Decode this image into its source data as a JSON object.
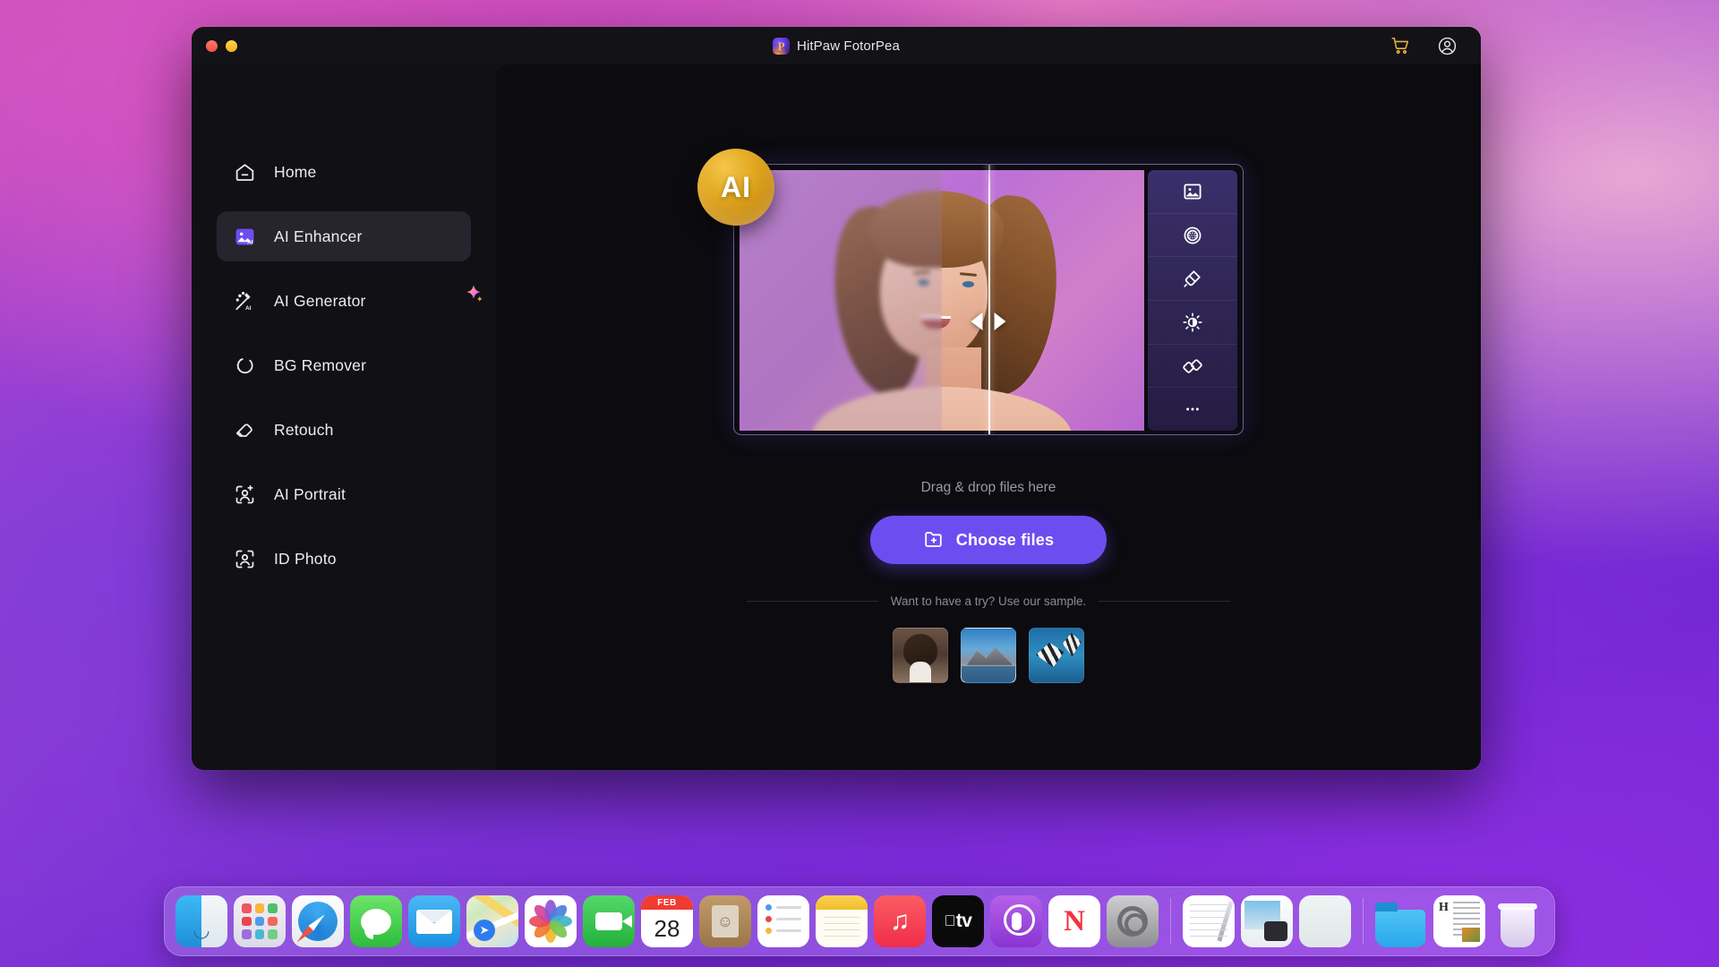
{
  "window": {
    "title": "HitPaw FotorPea",
    "logo_letter": "P",
    "traffic_lights": [
      "close",
      "minimize"
    ],
    "header_icons": [
      "cart-icon",
      "account-icon"
    ]
  },
  "sidebar": {
    "items": [
      {
        "label": "Home",
        "icon": "home-icon",
        "active": false,
        "badge": false
      },
      {
        "label": "AI Enhancer",
        "icon": "ai-enhancer-icon",
        "active": true,
        "badge": false
      },
      {
        "label": "AI Generator",
        "icon": "ai-generator-icon",
        "active": false,
        "badge": true
      },
      {
        "label": "BG Remover",
        "icon": "bg-remover-icon",
        "active": false,
        "badge": false
      },
      {
        "label": "Retouch",
        "icon": "retouch-icon",
        "active": false,
        "badge": false
      },
      {
        "label": "AI Portrait",
        "icon": "ai-portrait-icon",
        "active": false,
        "badge": false
      },
      {
        "label": "ID Photo",
        "icon": "id-photo-icon",
        "active": false,
        "badge": false
      }
    ]
  },
  "main": {
    "ai_badge_text": "AI",
    "preview_tools": [
      {
        "name": "image-enhance-icon"
      },
      {
        "name": "denoise-icon"
      },
      {
        "name": "stamp-icon"
      },
      {
        "name": "brightness-icon"
      },
      {
        "name": "patch-icon"
      },
      {
        "name": "more-options-icon"
      }
    ],
    "drop_text": "Drag & drop files here",
    "choose_files_label": "Choose files",
    "sample_prompt": "Want to have a try? Use our sample.",
    "samples": [
      {
        "name": "sample-portrait"
      },
      {
        "name": "sample-landscape"
      },
      {
        "name": "sample-fish"
      }
    ]
  },
  "colors": {
    "accent_purple": "#6c4ef0",
    "badge_gold": "#e0a51e",
    "window_bg": "#111015",
    "panel_bg": "#0c0b10",
    "active_item_bg": "#26242c"
  },
  "dock": {
    "apps": [
      {
        "label": "Finder",
        "icon": "finder-icon",
        "running": true
      },
      {
        "label": "Launchpad",
        "icon": "launchpad-icon",
        "running": false
      },
      {
        "label": "Safari",
        "icon": "safari-icon",
        "running": false
      },
      {
        "label": "Messages",
        "icon": "messages-icon",
        "running": false
      },
      {
        "label": "Mail",
        "icon": "mail-icon",
        "running": false
      },
      {
        "label": "Maps",
        "icon": "maps-icon",
        "running": false
      },
      {
        "label": "Photos",
        "icon": "photos-icon",
        "running": false
      },
      {
        "label": "FaceTime",
        "icon": "facetime-icon",
        "running": false
      },
      {
        "label": "Calendar",
        "icon": "calendar-icon",
        "running": false
      },
      {
        "label": "Contacts",
        "icon": "contacts-icon",
        "running": false
      },
      {
        "label": "Reminders",
        "icon": "reminders-icon",
        "running": false
      },
      {
        "label": "Notes",
        "icon": "notes-icon",
        "running": false
      },
      {
        "label": "Music",
        "icon": "music-icon",
        "running": false
      },
      {
        "label": "Apple TV",
        "icon": "appletv-icon",
        "running": false
      },
      {
        "label": "Podcasts",
        "icon": "podcasts-icon",
        "running": false
      },
      {
        "label": "News",
        "icon": "news-icon",
        "running": false
      },
      {
        "label": "System Settings",
        "icon": "system-settings-icon",
        "running": false
      },
      {
        "label": "TextEdit",
        "icon": "textedit-icon",
        "running": false
      },
      {
        "label": "Preview",
        "icon": "preview-icon",
        "running": false
      },
      {
        "label": "App",
        "icon": "blank-app-icon",
        "running": false
      },
      {
        "label": "Downloads",
        "icon": "folder-icon",
        "running": false
      },
      {
        "label": "Document",
        "icon": "document-icon",
        "running": false
      },
      {
        "label": "Trash",
        "icon": "trash-icon",
        "running": false
      }
    ],
    "calendar_month": "FEB",
    "calendar_day": "28",
    "appletv_label": "tv",
    "news_letter": "N",
    "contacts_letter": "☺",
    "maps_pin": "➤",
    "music_note": "♫",
    "document_letter": "H"
  }
}
